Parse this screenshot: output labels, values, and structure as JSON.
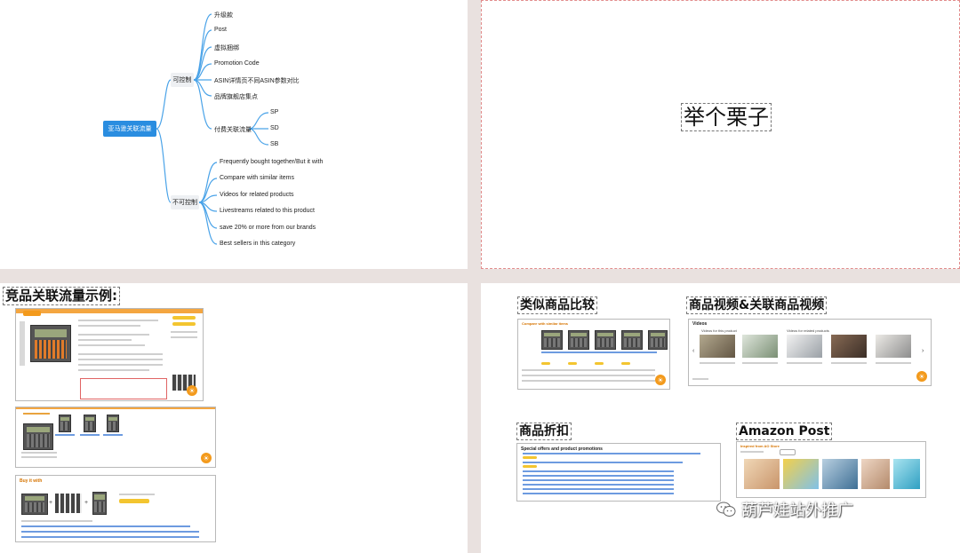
{
  "mindmap": {
    "root": "亚马逊关联流量",
    "branches": [
      {
        "label": "可控制",
        "items": [
          "升级款",
          "Post",
          "虚拟捆绑",
          "Promotion Code",
          "ASIN详情页不同ASIN参数对比",
          "品牌旗舰店集点"
        ],
        "paid": {
          "label": "付费关联流量",
          "items": [
            "SP",
            "SD",
            "SB"
          ]
        }
      },
      {
        "label": "不可控制",
        "items": [
          "Frequently bought together/But it with",
          "Compare with similar items",
          "Videos for related products",
          "Livestreams related to this product",
          "save 20% or more from our brands",
          "Best sellers in this category"
        ]
      }
    ]
  },
  "slide2": {
    "title": "举个栗子"
  },
  "slide3": {
    "title": "竞品关联流量示例:",
    "buy_it_with": "Buy it with"
  },
  "slide4": {
    "compare_title": "类似商品比较",
    "video_title": "商品视频&关联商品视频",
    "discount_title": "商品折扣",
    "post_title": "Amazon Post",
    "compare_header": "Compare with similar items",
    "videos_header": "Videos",
    "videos_for_product": "Videos for this product",
    "videos_related": "Videos for related products",
    "promo_header": "Special offers and product promotions",
    "post_header": "Inspired from AO Store"
  },
  "watermark": {
    "text": "葫芦娃站外推广",
    "icon": "wechat-icon"
  },
  "colors": {
    "root_blue": "#2a8de0",
    "accent_orange": "#f39a1c",
    "button_yellow": "#f3c530",
    "canvas": "#e9e1df"
  }
}
